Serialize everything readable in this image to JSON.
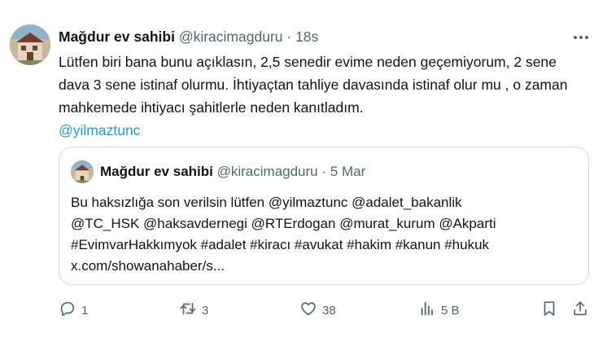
{
  "tweet": {
    "display_name": "Mağdur ev sahibi",
    "handle": "@kiracimagduru",
    "separator": "·",
    "time": "18s",
    "text": "Lütfen biri bana bunu açıklasın, 2,5 senedir evime neden geçemiyorum, 2 sene dava 3 sene istinaf olurmu. İhtiyaçtan tahliye davasında istinaf olur mu , o zaman mahkemede ihtiyacı şahitlerle neden kanıtladım.",
    "mention": "@yilmaztunc"
  },
  "quote": {
    "display_name": "Mağdur ev sahibi",
    "handle": "@kiracimagduru",
    "separator": "·",
    "date": "5 Mar",
    "line1": "Bu haksızlığa son verilsin lütfen @yilmaztunc @adalet_bakanlik",
    "line2": "@TC_HSK @haksavdernegi @RTErdogan @murat_kurum @Akparti",
    "line3": "#EvimvarHakkımyok  #adalet #kiracı #avukat #hakim #kanun #hukuk",
    "line4": "x.com/showanahaber/s..."
  },
  "actions": {
    "replies": "1",
    "reposts": "3",
    "likes": "38",
    "views": "5 B"
  },
  "icons": [
    "more-icon",
    "reply-icon",
    "repost-icon",
    "like-icon",
    "views-icon",
    "bookmark-icon",
    "share-icon"
  ],
  "colors": {
    "link": "#1d9bf0",
    "secondary": "#536471",
    "border": "#cfd9de"
  }
}
